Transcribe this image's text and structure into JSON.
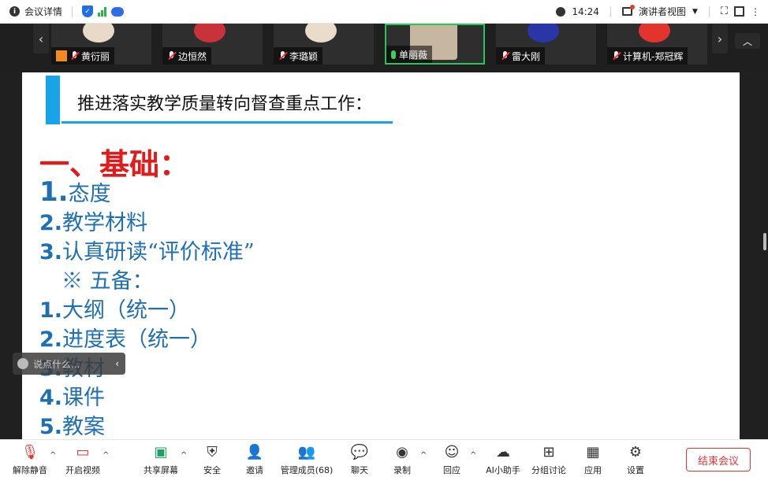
{
  "topbar": {
    "meeting_details": "会议详情",
    "time": "14:24",
    "speaker_view": "演讲者视图"
  },
  "participants": [
    {
      "name": "黄衍丽",
      "mic": "off",
      "avatar_color": "#e8d9c8"
    },
    {
      "name": "边恒然",
      "mic": "off",
      "avatar_color": "#c8323a"
    },
    {
      "name": "李璐颖",
      "mic": "off",
      "avatar_color": "#e9dccb"
    },
    {
      "name": "单丽薇",
      "mic": "on",
      "avatar_color": "#c7b7a0"
    },
    {
      "name": "雷大刚",
      "mic": "off",
      "avatar_color": "#2a36a8"
    },
    {
      "name": "计算机-郑冠辉",
      "mic": "off",
      "avatar_color": "#e2332c"
    }
  ],
  "slide": {
    "subtitle": "推进落实教学质量转向督查重点工作：",
    "heading": "一、基础：",
    "items": [
      {
        "num": "1.",
        "text": "态度"
      },
      {
        "num": "2.",
        "text": "教学材料"
      },
      {
        "num": "3.",
        "text": "认真研读“评价标准”"
      },
      {
        "num": "",
        "text": "※ 五备："
      },
      {
        "num": "1.",
        "text": "大纲（统一）"
      },
      {
        "num": "2.",
        "text": "进度表（统一）"
      },
      {
        "num": "3.",
        "text": "教材"
      },
      {
        "num": "4.",
        "text": "课件"
      },
      {
        "num": "5.",
        "text": "教案"
      }
    ]
  },
  "chat": {
    "placeholder": "说点什么..."
  },
  "toolbar": {
    "mute": "解除静音",
    "video": "开启视频",
    "share": "共享屏幕",
    "security": "安全",
    "invite": "邀请",
    "members": "管理成员(68)",
    "chat": "聊天",
    "record": "录制",
    "react": "回应",
    "ai": "AI小助手",
    "breakout": "分组讨论",
    "apps": "应用",
    "settings": "设置",
    "end": "结束会议"
  },
  "colors": {
    "accent": "#19a3e8",
    "heading_red": "#e21a1a",
    "list_blue": "#1f6fb3",
    "end_red": "#e33333"
  }
}
